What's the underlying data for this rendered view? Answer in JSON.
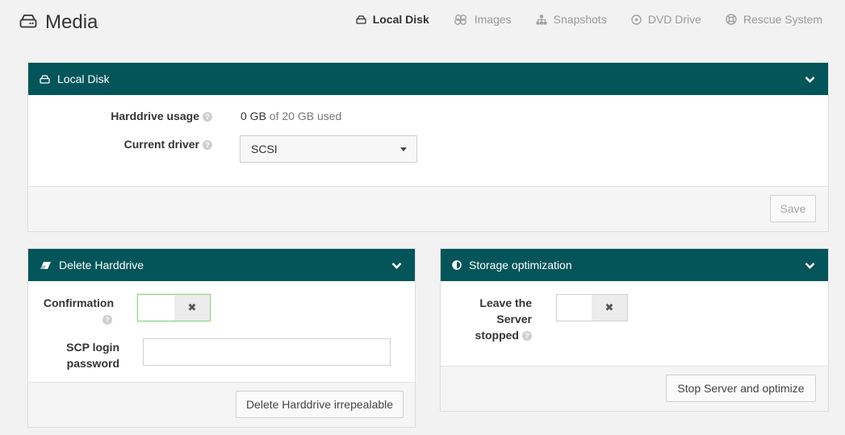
{
  "header": {
    "title": "Media",
    "nav": [
      {
        "label": "Local Disk",
        "icon": "hard-drive-icon",
        "active": true
      },
      {
        "label": "Images",
        "icon": "images-icon",
        "active": false
      },
      {
        "label": "Snapshots",
        "icon": "snapshots-icon",
        "active": false
      },
      {
        "label": "DVD Drive",
        "icon": "dvd-icon",
        "active": false
      },
      {
        "label": "Rescue System",
        "icon": "lifebuoy-icon",
        "active": false
      }
    ]
  },
  "colors": {
    "panel_header": "#03555a",
    "background": "#f2f2f2"
  },
  "local_disk": {
    "title": "Local Disk",
    "usage_label": "Harddrive usage",
    "usage_used": "0 GB",
    "usage_rest": "of 20 GB used",
    "driver_label": "Current driver",
    "driver_value": "SCSI",
    "save_label": "Save"
  },
  "delete_harddrive": {
    "title": "Delete Harddrive",
    "confirmation_label": "Confirmation",
    "confirmation_state": "off",
    "toggle_off_glyph": "✖",
    "scp_label_line1": "SCP login",
    "scp_label_line2": "password",
    "scp_value": "",
    "button_label": "Delete Harddrive irrepealable"
  },
  "storage_optimization": {
    "title": "Storage optimization",
    "leave_label_line1": "Leave the",
    "leave_label_line2": "Server",
    "leave_label_line3": "stopped",
    "leave_state": "off",
    "toggle_off_glyph": "✖",
    "button_label": "Stop Server and optimize"
  },
  "help_glyph": "?"
}
